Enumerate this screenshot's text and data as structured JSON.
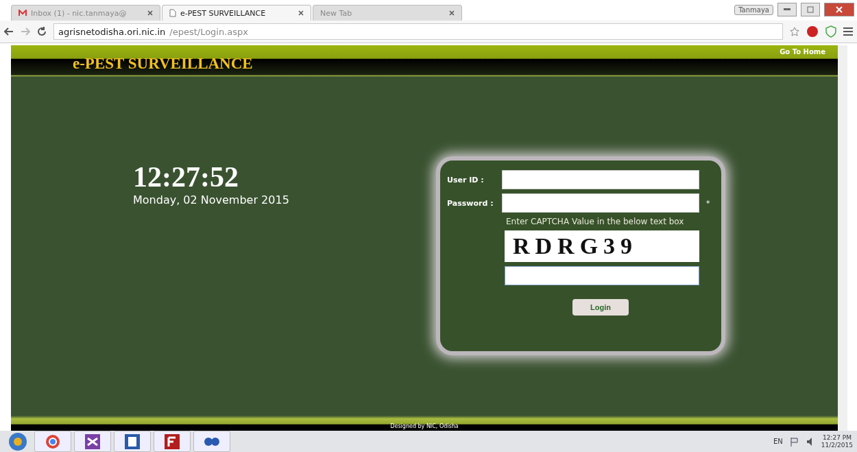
{
  "browser": {
    "tabs": [
      {
        "title": "Inbox (1) - nic.tanmaya@",
        "kind": "mail",
        "selected": false
      },
      {
        "title": "e-PEST SURVEILLANCE",
        "kind": "page",
        "selected": true
      },
      {
        "title": "New Tab",
        "kind": "blank",
        "selected": false
      }
    ],
    "profile": "Tanmaya",
    "url_host": "agrisnetodisha.ori.nic.in",
    "url_path": "/epest/Login.aspx"
  },
  "header": {
    "title": "e-PEST SURVEILLANCE",
    "home_link": "Go To Home"
  },
  "clock": {
    "time": "12:27:52",
    "date": "Monday, 02 November 2015"
  },
  "login": {
    "user_label": "User ID :",
    "password_label": "Password :",
    "required_mark": "*",
    "captcha_hint": "Enter CAPTCHA Value in the below text box",
    "captcha": "RDRG39",
    "button": "Login"
  },
  "footer": {
    "text": "Designed by NIC, Odisha"
  },
  "taskbar": {
    "language": "EN",
    "time": "12:27 PM",
    "date": "11/2/2015"
  }
}
